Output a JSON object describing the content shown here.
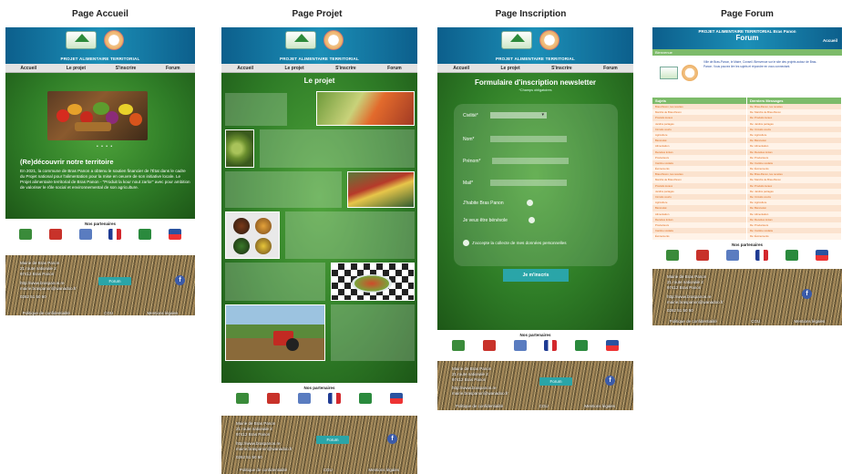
{
  "columns": {
    "accueil": {
      "caption": "Page Accueil"
    },
    "projet": {
      "caption": "Page Projet"
    },
    "inscription": {
      "caption": "Page Inscription"
    },
    "forum": {
      "caption": "Page Forum"
    }
  },
  "header": {
    "subtitle": "PROJET ALIMENTAIRE TERRITORIAL"
  },
  "nav": {
    "accueil": "Accueil",
    "projet": "Le projet",
    "inscrire": "S'inscrire",
    "forum": "Forum"
  },
  "accueil": {
    "hero_title": "(Re)découvrir notre territoire",
    "hero_text": "En 2021, la commune de Bras Panon a obtenu le soutien financier de l'État dans le cadre du Projet national pour l'alimentation pour la mise en oeuvre de son initiative locale. Le Projet alimentaire territorial de Bras Panon - \"Produit la kour nout zarlor\" avec pour ambition de valoriser le rôle social et environnemental de son agriculture."
  },
  "projet": {
    "title": "Le projet"
  },
  "inscription": {
    "title": "Formulaire d'inscription newsletter",
    "subtitle": "*Champs obligatoires",
    "civility_label": "Civilité*",
    "civility_value": "",
    "name_label": "Nom*",
    "firstname_label": "Prénom*",
    "mail_label": "Mail*",
    "resident_label": "J'habite Bras Panon",
    "volunteer_label": "Je veux être bénévole",
    "consent_label": "J'accepte la collecte de mes données personnelles",
    "submit": "Je m'inscris"
  },
  "forum": {
    "top": "PROJET ALIMENTAIRE TERRITORIAL Bras Panon",
    "title": "Forum",
    "accueil": "Accueil",
    "bar": "Bienvenue",
    "intro": "Ville de Bras-Panon, le Maire, Conseil. Bienvenue sur le site des projets autour de Bras-Panon. Vous pouvez lire les sujets et répondre en vous connectant.",
    "col_sujets": "Sujets",
    "col_messages": "Derniers Messages",
    "rows": [
      [
        "Bras-Panon, les recettes",
        "Re: Bras-Panon, les recettes"
      ],
      [
        "Marché de Bras-Panon",
        "Re: Marché de Bras-Panon"
      ],
      [
        "Produits locaux",
        "Re: Produits locaux"
      ],
      [
        "Jardins partagés",
        "Re: Jardins partagés"
      ],
      [
        "Circuits courts",
        "Re: Circuits courts"
      ],
      [
        "Agriculture",
        "Re: Agriculture"
      ],
      [
        "Bénévolat",
        "Re: Bénévolat"
      ],
      [
        "Alimentation",
        "Re: Alimentation"
      ],
      [
        "Recettes lontan",
        "Re: Recettes lontan"
      ],
      [
        "Producteurs",
        "Re: Producteurs"
      ],
      [
        "Cantine scolaire",
        "Re: Cantine scolaire"
      ],
      [
        "Événements",
        "Re: Événements"
      ],
      [
        "Bras-Panon, les recettes",
        "Re: Bras-Panon, les recettes"
      ],
      [
        "Marché de Bras-Panon",
        "Re: Marché de Bras-Panon"
      ],
      [
        "Produits locaux",
        "Re: Produits locaux"
      ],
      [
        "Jardins partagés",
        "Re: Jardins partagés"
      ],
      [
        "Circuits courts",
        "Re: Circuits courts"
      ],
      [
        "Agriculture",
        "Re: Agriculture"
      ],
      [
        "Bénévolat",
        "Re: Bénévolat"
      ],
      [
        "Alimentation",
        "Re: Alimentation"
      ],
      [
        "Recettes lontan",
        "Re: Recettes lontan"
      ],
      [
        "Producteurs",
        "Re: Producteurs"
      ],
      [
        "Cantine scolaire",
        "Re: Cantine scolaire"
      ],
      [
        "Événements",
        "Re: Événements"
      ]
    ]
  },
  "partners": {
    "title": "Nos partenaires"
  },
  "footer": {
    "addr1": "Mairie de Bras Panon",
    "addr2": "21 route nationale 2",
    "addr3": "97412 Bras Panon",
    "web": "http://www.braspanon.re",
    "mail": "mairie.braspanon@wanadoo.fr",
    "phone": "0262 51 50 50",
    "forum_btn": "Forum",
    "privacy": "Politique de confidentialité",
    "cgu": "CGU",
    "legal": "Mentions légales"
  }
}
